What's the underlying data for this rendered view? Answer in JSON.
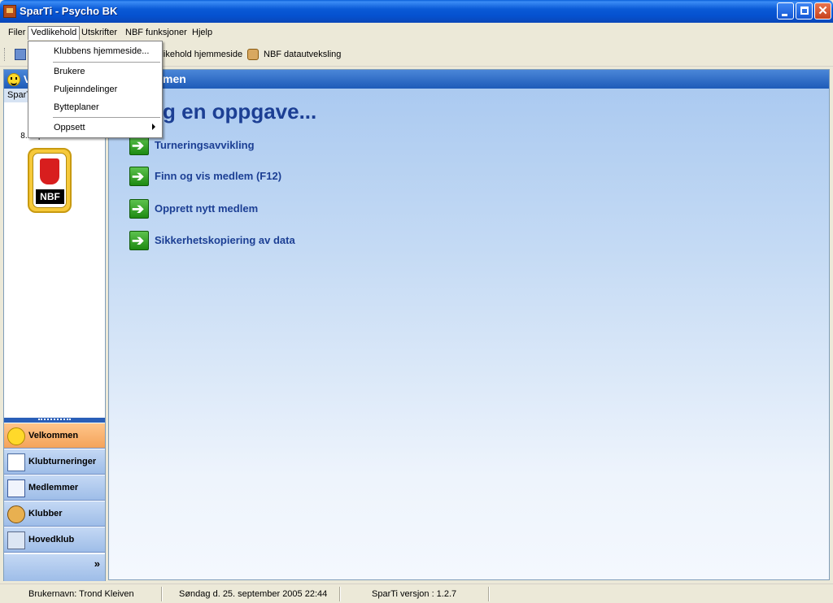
{
  "window": {
    "title": "SparTi - Psycho BK"
  },
  "menubar": {
    "items": [
      "Filer",
      "Vedlikehold",
      "Utskrifter",
      "NBF funksjoner",
      "Hjelp"
    ]
  },
  "dropdown": {
    "items": [
      "Klubbens hjemmeside...",
      "Brukere",
      "Puljeinndelinger",
      "Bytteplaner",
      "Oppsett"
    ]
  },
  "toolbar": {
    "items": [
      "llikehold hjemmeside",
      "NBF datautveksling"
    ]
  },
  "leftpanel": {
    "header": "V",
    "subheader": "SparTi",
    "welcome_line1": "W",
    "welcome_line2": "8. september 2005",
    "logo_text": "NBF",
    "nav": [
      "Velkommen",
      "Klubturneringer",
      "Medlemmer",
      "Klubber",
      "Hovedklub"
    ],
    "more": "»"
  },
  "main": {
    "header": "men",
    "heading": "g en oppgave...",
    "tasks": [
      "Turneringsavvikling",
      "Finn og vis medlem (F12)",
      "Opprett nytt medlem",
      "Sikkerhetskopiering av data"
    ],
    "task_icon": "green-arrow-icon"
  },
  "statusbar": {
    "user": "Brukernavn: Trond Kleiven",
    "date": "Søndag d. 25. september 2005 22:44",
    "version": "SparTi versjon : 1.2.7"
  },
  "colors": {
    "accent": "#1c3f94",
    "titlebar": "#0a5ad6",
    "active_nav": "#f4a35a"
  }
}
